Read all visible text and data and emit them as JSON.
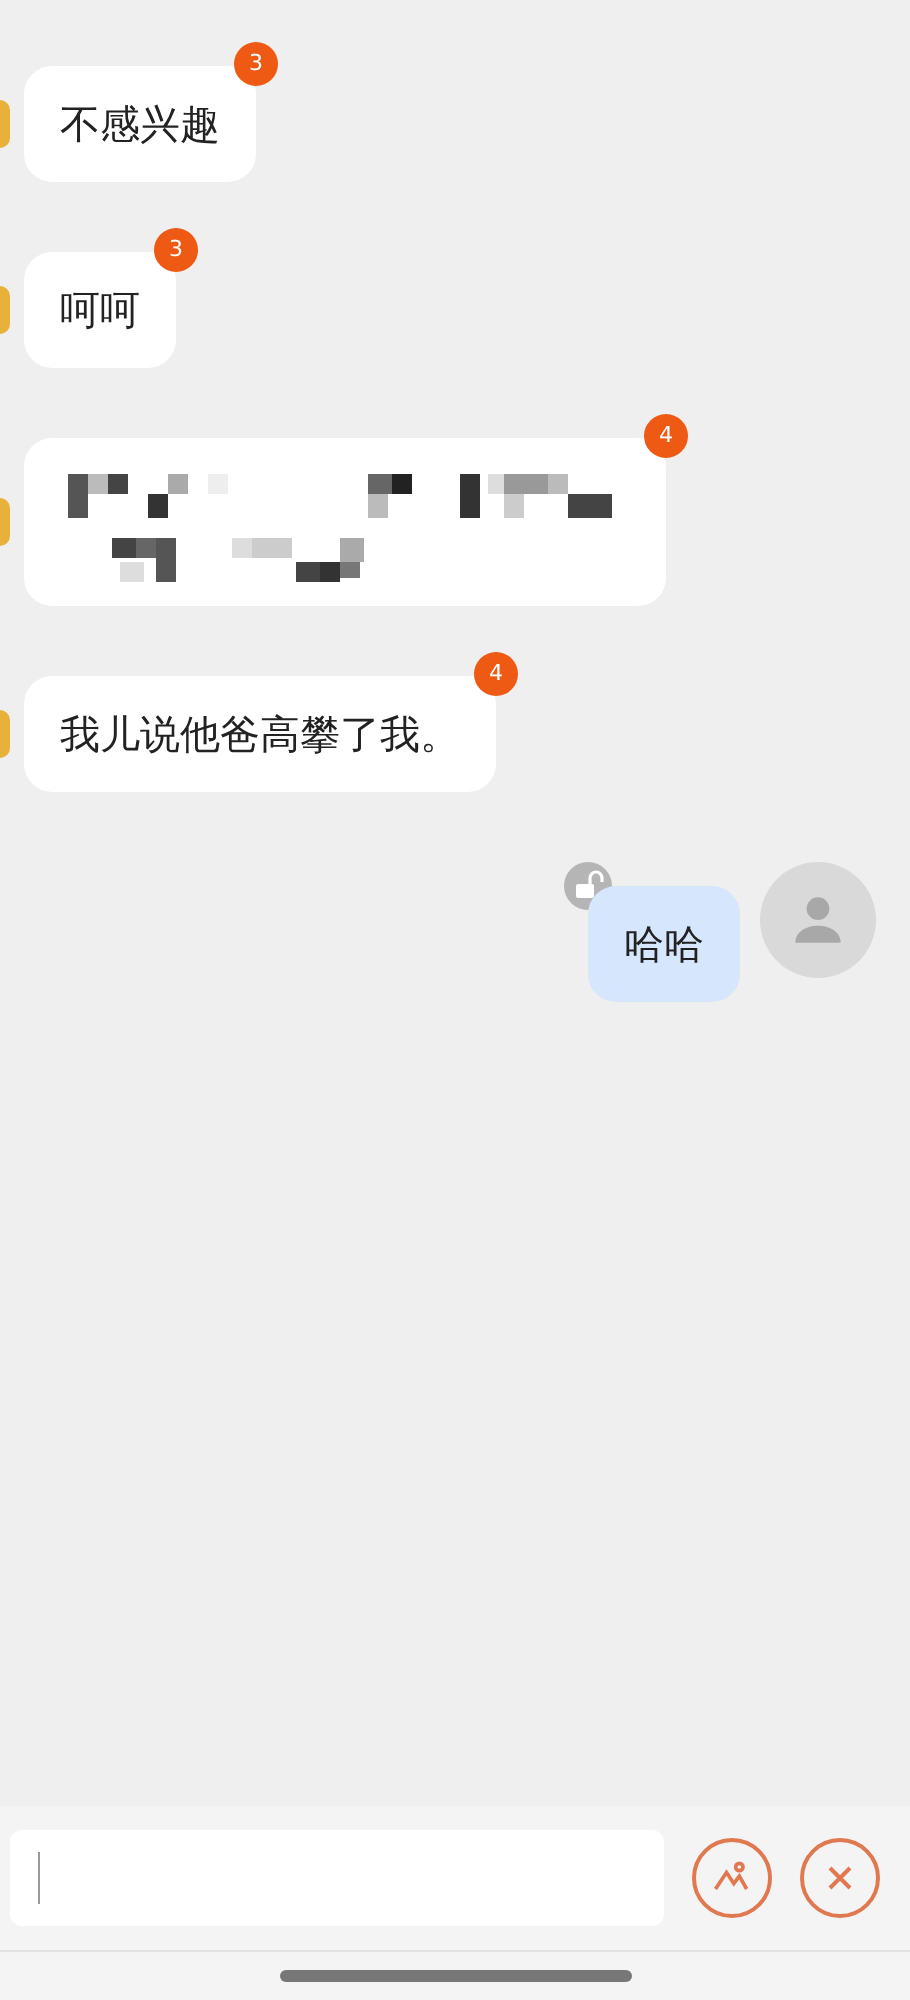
{
  "messages": [
    {
      "outgoing": false,
      "kind": "text",
      "text": "不感兴趣",
      "badge": "3"
    },
    {
      "outgoing": false,
      "kind": "text",
      "text": "呵呵",
      "badge": "3"
    },
    {
      "outgoing": false,
      "kind": "censored",
      "badge": "4"
    },
    {
      "outgoing": false,
      "kind": "text",
      "text": "我儿说他爸高攀了我。",
      "badge": "4"
    },
    {
      "outgoing": true,
      "kind": "text",
      "text": "哈哈"
    }
  ]
}
